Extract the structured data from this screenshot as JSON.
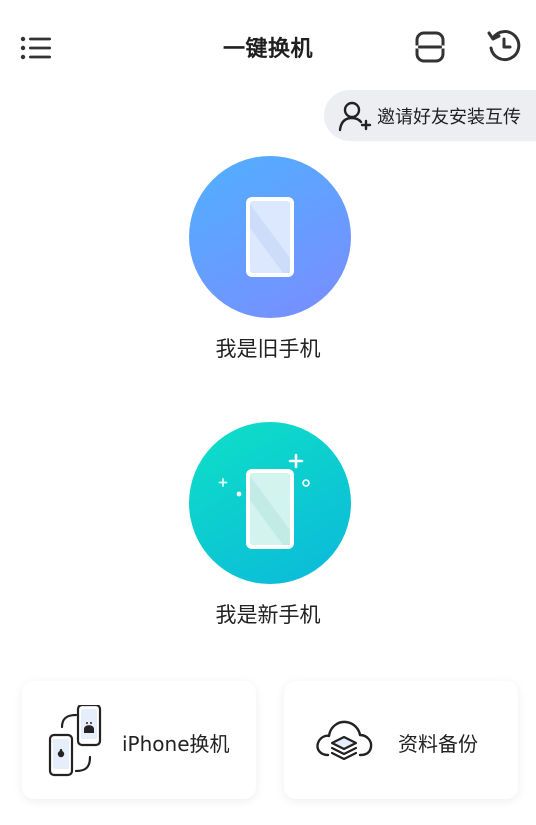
{
  "header": {
    "title": "一键换机",
    "menu_icon": "list-menu-icon",
    "scan_icon": "scan-icon",
    "history_icon": "history-icon"
  },
  "invite": {
    "icon": "add-user-icon",
    "label": "邀请好友安装互传"
  },
  "options": {
    "old_phone": {
      "label": "我是旧手机",
      "icon": "phone-icon"
    },
    "new_phone": {
      "label": "我是新手机",
      "icon": "new-phone-icon"
    }
  },
  "cards": {
    "iphone_switch": {
      "label": "iPhone换机",
      "icon": "phone-transfer-icon"
    },
    "data_backup": {
      "label": "资料备份",
      "icon": "cloud-backup-icon"
    }
  },
  "colors": {
    "old_phone_gradient": [
      "#4fb0ff",
      "#7b8cff"
    ],
    "new_phone_gradient": [
      "#0ee0c6",
      "#0bb8db"
    ],
    "invite_pill": "#eceef2"
  }
}
